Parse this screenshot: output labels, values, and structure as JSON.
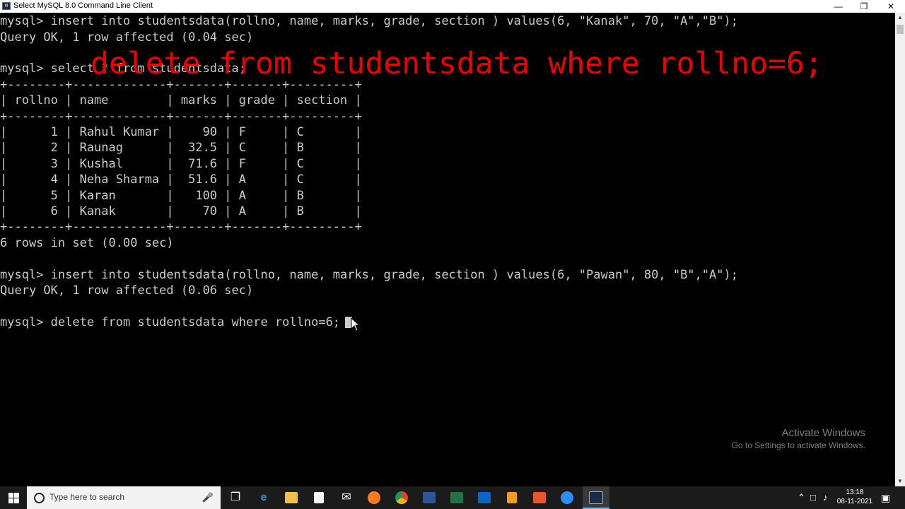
{
  "window": {
    "title": "Select MySQL 8.0 Command Line Client",
    "app_icon": "mysql-console-icon",
    "controls": [
      "minimize",
      "restore",
      "close"
    ]
  },
  "console": {
    "lines": [
      "mysql> insert into studentsdata(rollno, name, marks, grade, section ) values(6, \"Kanak\", 70, \"A\",\"B\");",
      "Query OK, 1 row affected (0.04 sec)",
      "",
      "mysql> select * from studentsdata;",
      "+--------+-------------+-------+-------+---------+",
      "| rollno | name        | marks | grade | section |",
      "+--------+-------------+-------+-------+---------+",
      "|      1 | Rahul Kumar |    90 | F     | C       |",
      "|      2 | Raunag      |  32.5 | C     | B       |",
      "|      3 | Kushal      |  71.6 | F     | C       |",
      "|      4 | Neha Sharma |  51.6 | A     | C       |",
      "|      5 | Karan       |   100 | A     | B       |",
      "|      6 | Kanak       |    70 | A     | B       |",
      "+--------+-------------+-------+-------+---------+",
      "6 rows in set (0.00 sec)",
      "",
      "mysql> insert into studentsdata(rollno, name, marks, grade, section ) values(6, \"Pawan\", 80, \"B\",\"A\");",
      "Query OK, 1 row affected (0.06 sec)",
      "",
      "mysql> delete from studentsdata where rollno=6;"
    ],
    "overlay_text": "delete from studentsdata where rollno=6;",
    "overlay_color": "#e00000",
    "text_color": "#cccccc"
  },
  "watermark": {
    "heading": "Activate Windows",
    "subtext": "Go to Settings to activate Windows."
  },
  "taskbar": {
    "search_placeholder": "Type here to search",
    "pinned": [
      "task-view-icon",
      "edge-icon",
      "file-explorer-icon",
      "store-icon",
      "mail-icon",
      "firefox-icon",
      "chrome-icon",
      "word-icon",
      "excel-icon",
      "app-icon",
      "sublime-icon",
      "app-orange-icon",
      "zoom-icon",
      "mysql-console-icon"
    ],
    "time": "13:18",
    "date": "08-11-2021"
  }
}
